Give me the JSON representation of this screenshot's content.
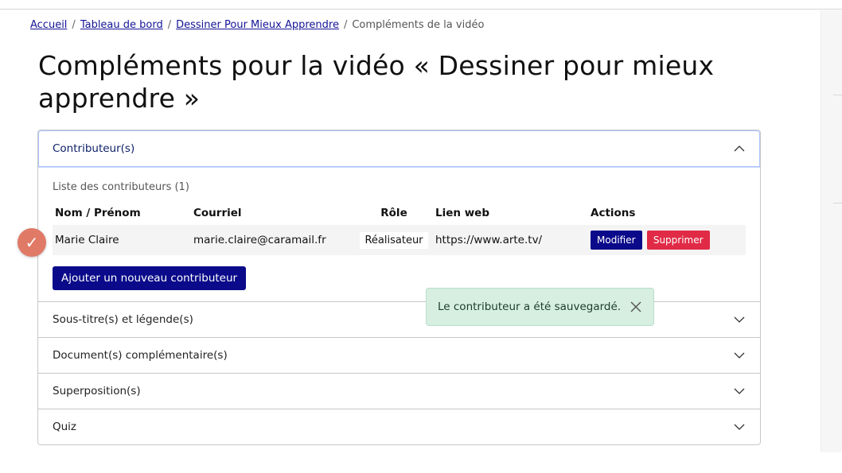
{
  "breadcrumb": {
    "home": "Accueil",
    "dashboard": "Tableau de bord",
    "video": "Dessiner Pour Mieux Apprendre",
    "current": "Compléments de la vidéo",
    "separator": "/"
  },
  "page": {
    "title": "Compléments pour la vidéo « Dessiner pour mieux apprendre »"
  },
  "accordion": {
    "contributors": {
      "label": "Contributeur(s)",
      "list_caption": "Liste des contributeurs (1)",
      "columns": [
        "Nom / Prénom",
        "Courriel",
        "Rôle",
        "Lien web",
        "Actions"
      ],
      "rows": [
        {
          "name": "Marie Claire",
          "email": "marie.claire@caramail.fr",
          "role": "Réalisateur",
          "web": "https://www.arte.tv/",
          "edit_label": "Modifier",
          "delete_label": "Supprimer"
        }
      ],
      "add_label": "Ajouter un nouveau contributeur"
    },
    "subtitles": {
      "label": "Sous-titre(s) et légende(s)"
    },
    "documents": {
      "label": "Document(s) complémentaire(s)"
    },
    "overlays": {
      "label": "Superposition(s)"
    },
    "quiz": {
      "label": "Quiz"
    }
  },
  "toast": {
    "message": "Le contributeur a été sauvegardé.",
    "color": "#d6efe1"
  },
  "colors": {
    "primary_button": "#0a0a8a",
    "danger_button": "#e02a46",
    "check_badge": "#e07a67"
  },
  "icons": {
    "chevron_up": "chevron-up-icon",
    "chevron_down": "chevron-down-icon",
    "close": "close-icon",
    "check": "check-icon"
  }
}
